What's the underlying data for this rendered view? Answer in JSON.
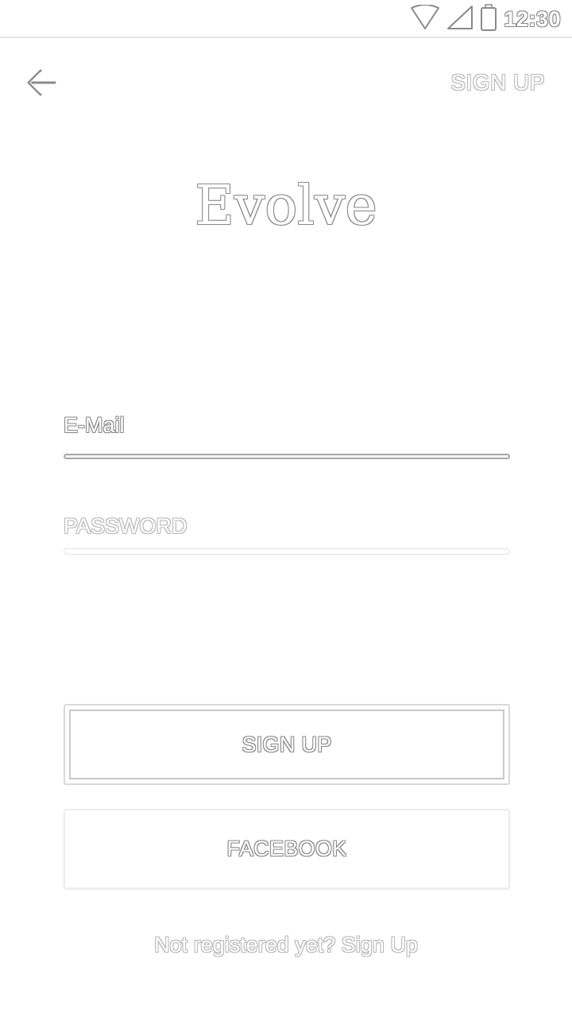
{
  "status_bar": {
    "time": "12:30",
    "icons": [
      "wifi-icon",
      "cell-signal-icon",
      "battery-icon"
    ]
  },
  "top_bar": {
    "back_icon": "arrow-left-icon",
    "signup_label": "SIGN UP"
  },
  "logo": {
    "text": "Evolve"
  },
  "form": {
    "email_label": "E-Mail",
    "email_value": "",
    "password_label": "PASSWORD",
    "password_value": ""
  },
  "buttons": {
    "signup_label": "SIGN UP",
    "facebook_label": "FACEBOOK"
  },
  "footer": {
    "register_text": "Not registered yet? Sign Up"
  },
  "colors": {
    "background": "#ffffff",
    "outline": "#8a8a8a",
    "divider": "#e4e4e4"
  }
}
